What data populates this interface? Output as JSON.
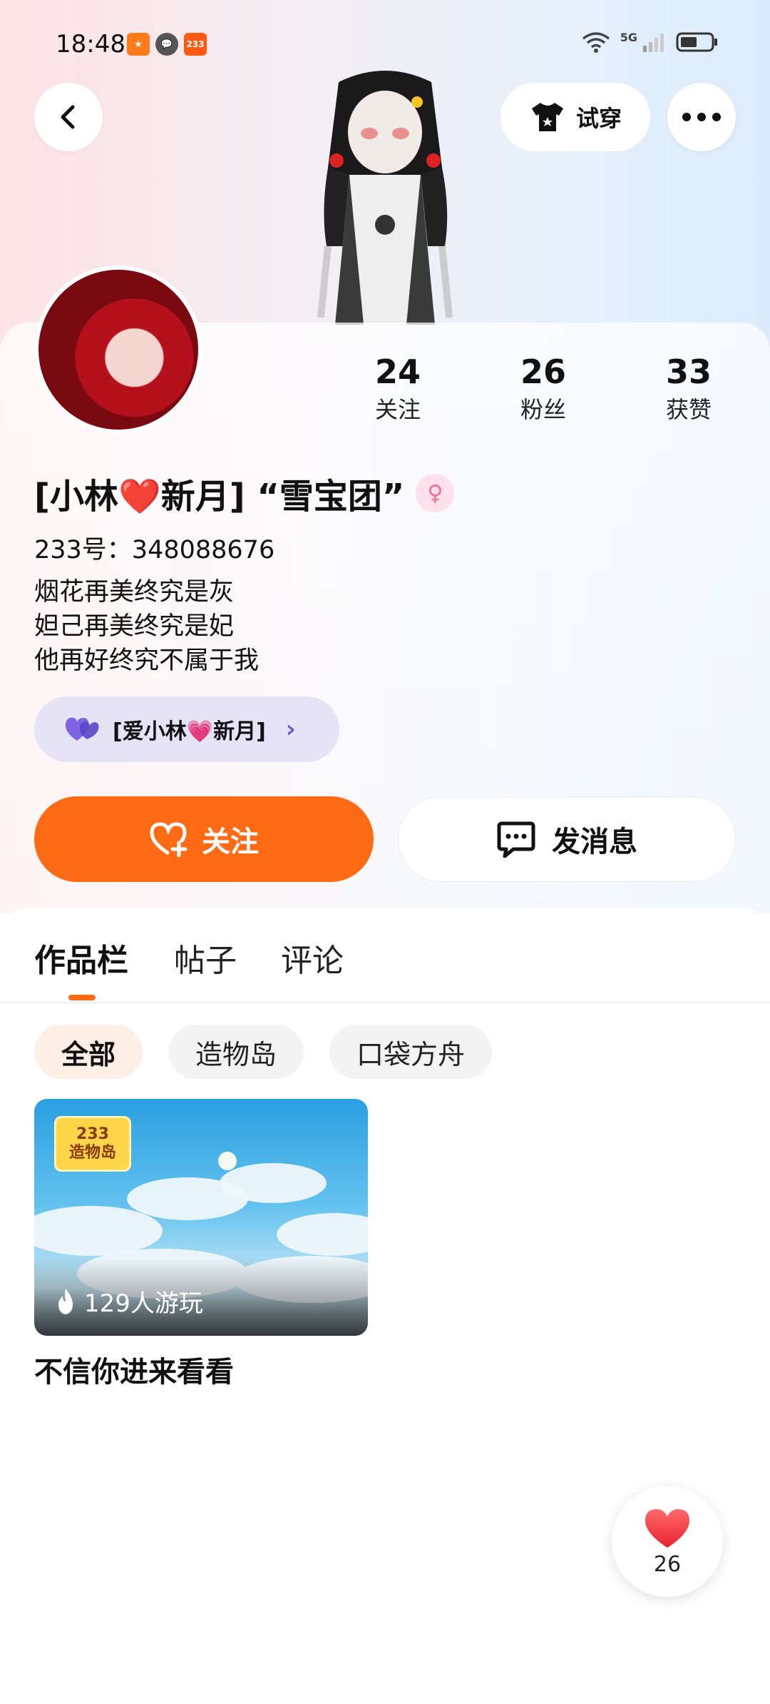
{
  "status_bar": {
    "time": "18:48",
    "network": "5G",
    "app_badge_text": "233"
  },
  "header": {
    "try_on_label": "试穿"
  },
  "stats": [
    {
      "value": "24",
      "label": "关注"
    },
    {
      "value": "26",
      "label": "粉丝"
    },
    {
      "value": "33",
      "label": "获赞"
    }
  ],
  "profile": {
    "nickname": "[小林❤️新月]  “雪宝团”",
    "gender_symbol": "♀",
    "uid": "233号：348088676",
    "bio_lines": [
      "烟花再美终究是灰",
      "妲己再美终究是妃",
      "他再好终究不属于我"
    ],
    "group_tag": "[爱小林💗新月]"
  },
  "actions": {
    "follow_label": "关注",
    "message_label": "发消息"
  },
  "tabs": [
    {
      "label": "作品栏",
      "active": true
    },
    {
      "label": "帖子",
      "active": false
    },
    {
      "label": "评论",
      "active": false
    }
  ],
  "filters": [
    {
      "label": "全部",
      "active": true
    },
    {
      "label": "造物岛",
      "active": false
    },
    {
      "label": "口袋方舟",
      "active": false
    }
  ],
  "works": [
    {
      "title": "不信你进来看看",
      "plays": "129人游玩",
      "logo_top": "233",
      "logo_bottom": "造物岛"
    }
  ],
  "like_fab": {
    "count": "26"
  },
  "colors": {
    "accent": "#ff6a14",
    "purple_tag": "#e6e3f6"
  }
}
